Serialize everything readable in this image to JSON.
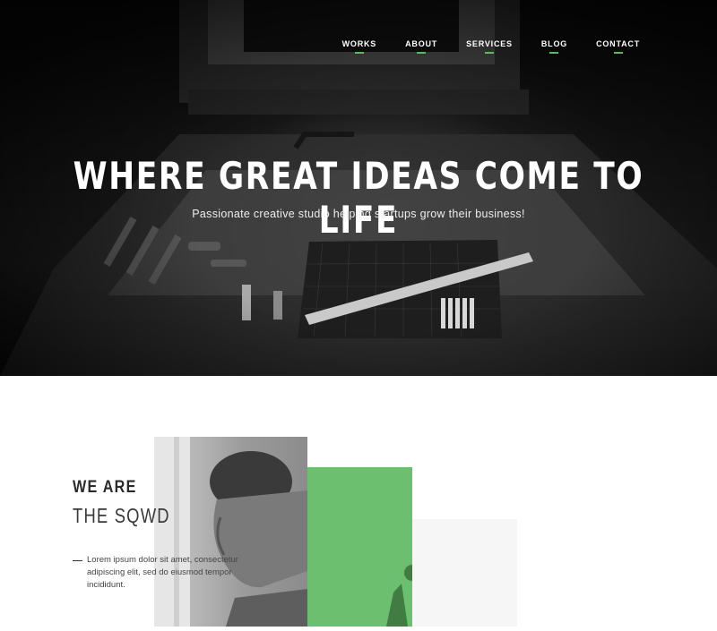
{
  "nav": {
    "items": [
      {
        "label": "WORKS"
      },
      {
        "label": "ABOUT"
      },
      {
        "label": "SERVICES"
      },
      {
        "label": "BLOG"
      },
      {
        "label": "CONTACT"
      }
    ],
    "accent_color": "#5cb85c"
  },
  "hero": {
    "title": "WHERE GREAT IDEAS COME TO LIFE",
    "subtitle": "Passionate creative studio helping startups grow their business!"
  },
  "about": {
    "heading_line1": "WE ARE",
    "heading_line2": "THE SQWD",
    "body": "Lorem ipsum dolor sit amet, consectetur adipiscing elit, sed do eiusmod tempor incididunt.",
    "accent_color": "#6cbf6e"
  }
}
